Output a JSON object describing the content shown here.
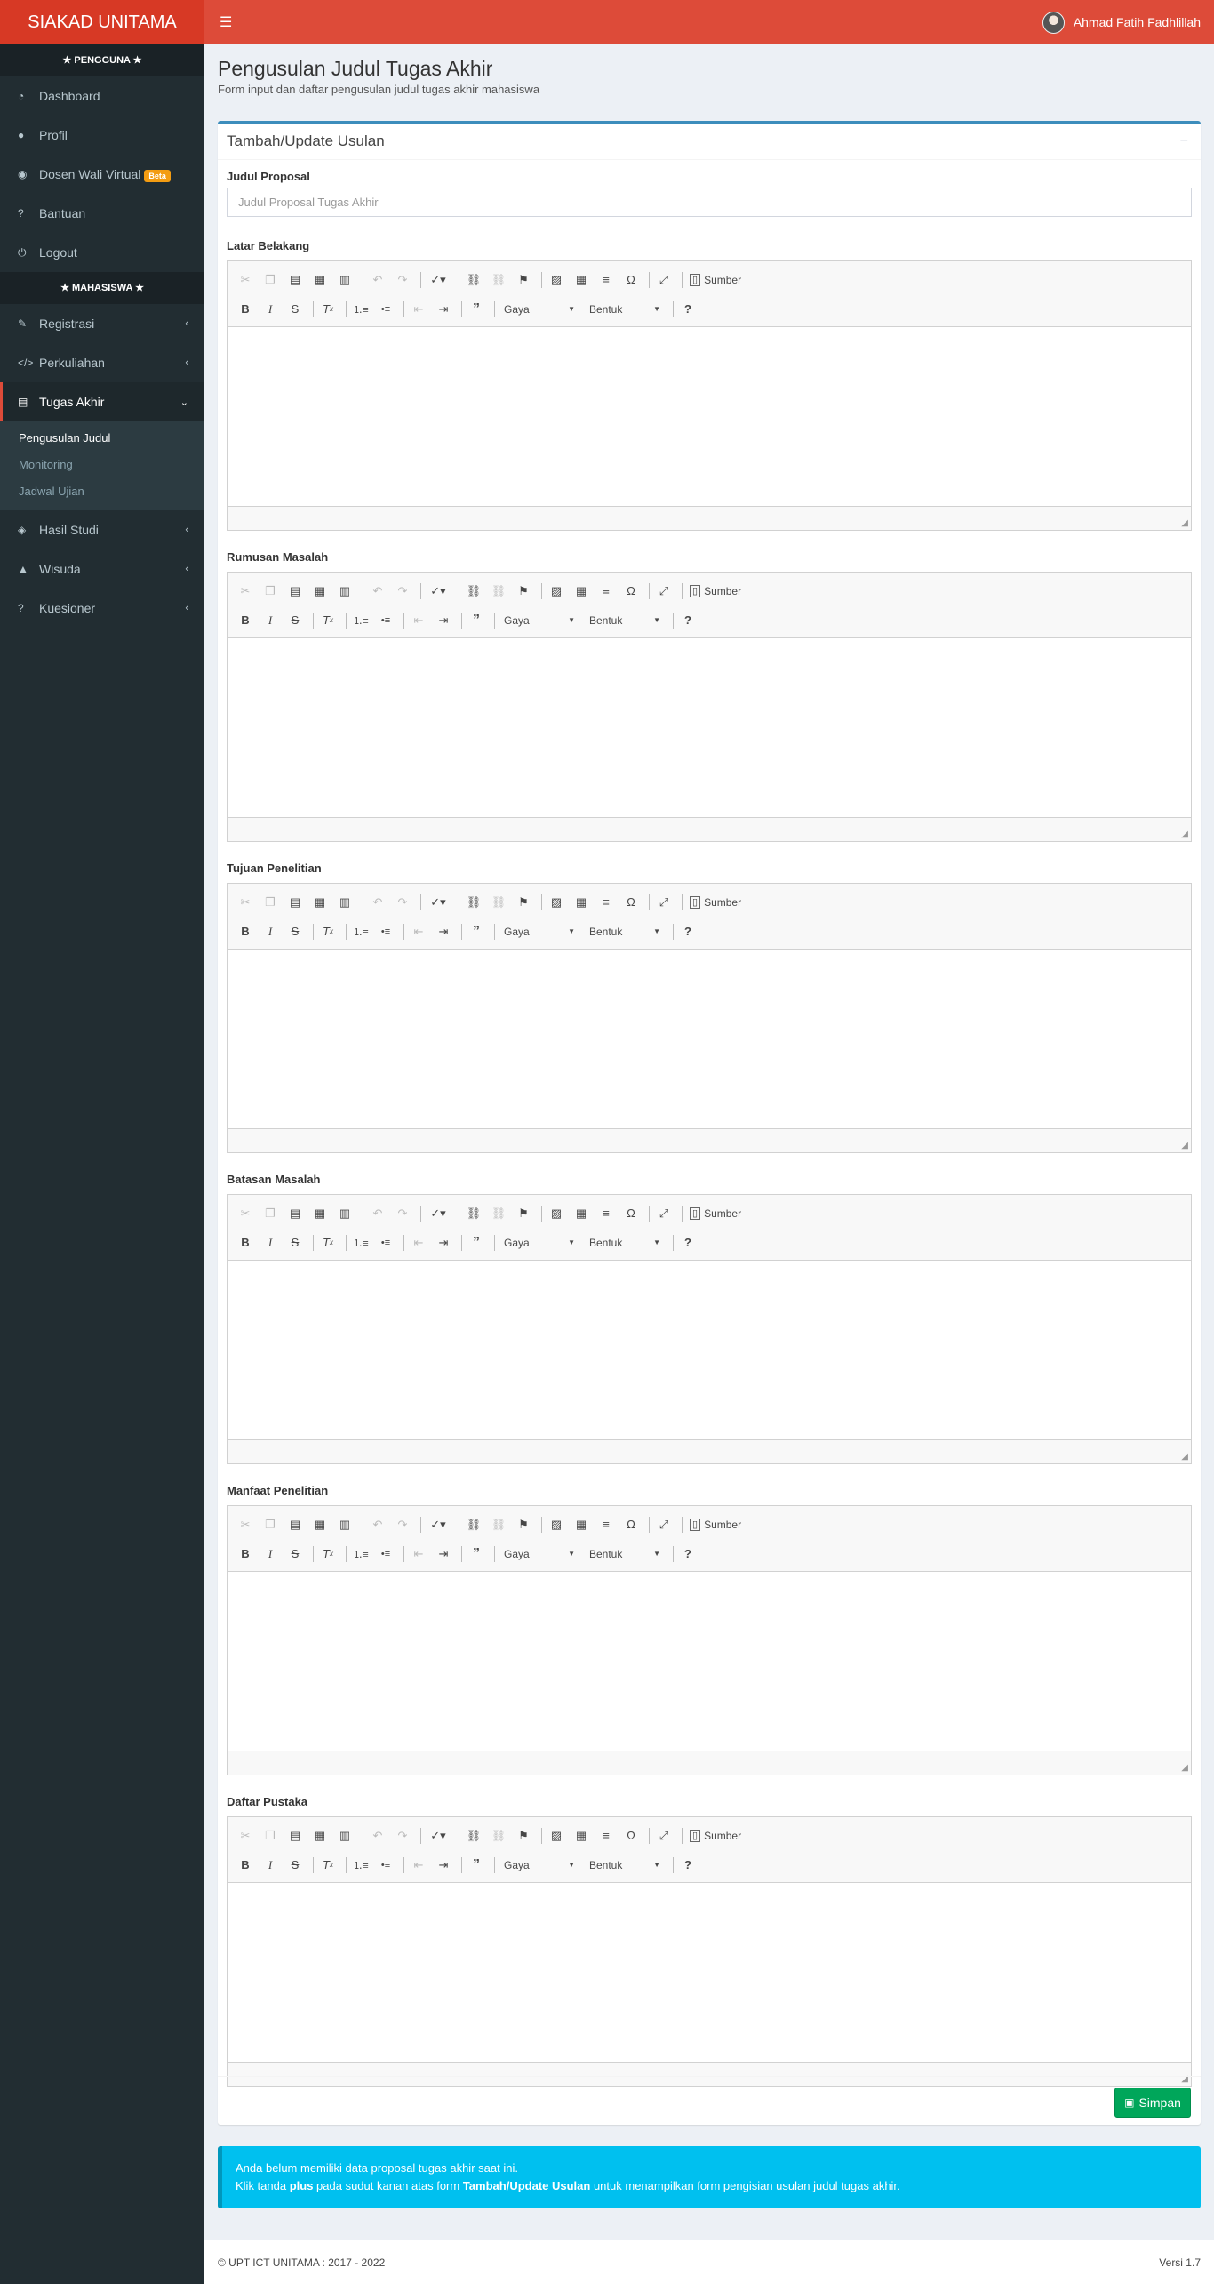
{
  "app": {
    "title": "SIAKAD UNITAMA"
  },
  "topbar": {
    "menu_icon": "☰",
    "user_name": "Ahmad Fatih Fadhlillah"
  },
  "sidebar": {
    "header_pengguna": "★ PENGGUNA ★",
    "pengguna_items": [
      {
        "label": "Dashboard",
        "icon": "dashboard-icon",
        "glyph": "◔"
      },
      {
        "label": "Profil",
        "icon": "user-icon",
        "glyph": "●"
      },
      {
        "label": "Dosen Wali Virtual",
        "icon": "chat-icon",
        "glyph": "◉",
        "badge": "Beta"
      },
      {
        "label": "Bantuan",
        "icon": "question-icon",
        "glyph": "?"
      },
      {
        "label": "Logout",
        "icon": "power-icon",
        "glyph": "⏻"
      }
    ],
    "header_mahasiswa": "★ MAHASISWA ★",
    "mahasiswa_items": [
      {
        "label": "Registrasi",
        "icon": "edit-icon",
        "glyph": "✎"
      },
      {
        "label": "Perkuliahan",
        "icon": "code-icon",
        "glyph": "</>"
      },
      {
        "label": "Tugas Akhir",
        "icon": "file-icon",
        "glyph": "▤"
      },
      {
        "label": "Hasil Studi",
        "icon": "diamond-icon",
        "glyph": "◈"
      },
      {
        "label": "Wisuda",
        "icon": "graduation-cap-icon",
        "glyph": "🎓"
      },
      {
        "label": "Kuesioner",
        "icon": "question-icon",
        "glyph": "?"
      }
    ],
    "tugas_akhir_sub": [
      "Pengusulan Judul",
      "Monitoring",
      "Jadwal Ujian"
    ]
  },
  "page": {
    "title": "Pengusulan Judul Tugas Akhir",
    "subtitle": "Form input dan daftar pengusulan judul tugas akhir mahasiswa"
  },
  "box": {
    "title": "Tambah/Update Usulan",
    "collapse_symbol": "−"
  },
  "form": {
    "judul_label": "Judul Proposal",
    "judul_placeholder": "Judul Proposal Tugas Akhir",
    "editors": [
      {
        "label": "Latar Belakang"
      },
      {
        "label": "Rumusan Masalah"
      },
      {
        "label": "Tujuan Penelitian"
      },
      {
        "label": "Batasan Masalah"
      },
      {
        "label": "Manfaat Penelitian"
      },
      {
        "label": "Daftar Pustaka"
      }
    ],
    "toolbar": {
      "sumber": "Sumber",
      "gaya": "Gaya",
      "bentuk": "Bentuk"
    },
    "save_label": "Simpan"
  },
  "callout": {
    "line1": "Anda belum memiliki data proposal tugas akhir saat ini.",
    "line2_a": "Klik tanda ",
    "line2_b": "plus",
    "line2_c": " pada sudut kanan atas form ",
    "line2_d": "Tambah/Update Usulan",
    "line2_e": " untuk menampilkan form pengisian usulan judul tugas akhir."
  },
  "footer": {
    "left": "© UPT ICT UNITAMA : 2017 - 2022",
    "right": "Versi 1.7"
  }
}
